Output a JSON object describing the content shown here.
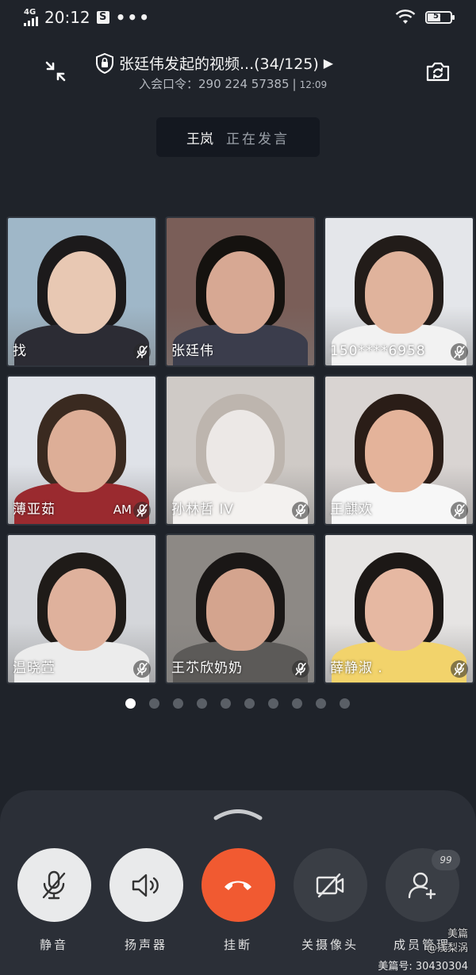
{
  "status_bar": {
    "network": "4G",
    "time": "20:12",
    "extra_icon": "S",
    "dots": "•••",
    "battery": "57",
    "battery_level": 0.57
  },
  "header": {
    "title": "张廷伟发起的视频...(34/125)",
    "code_label": "入会口令：290 224 57385",
    "separator": "|",
    "duration": "12:09"
  },
  "speaker": {
    "name": "王岚",
    "status": "正在发言"
  },
  "participants": [
    {
      "name": "找",
      "muted": true,
      "bg": "#9fb7c8",
      "skin": "#e8c8b3",
      "hair": "#1c1a1b",
      "shirt": "#2c2c34",
      "extra": ""
    },
    {
      "name": "张廷伟",
      "muted": false,
      "bg": "#7a5e58",
      "skin": "#d7a893",
      "hair": "#15120f",
      "shirt": "#3b3d4c",
      "extra": ""
    },
    {
      "name": "150****6958",
      "muted": true,
      "bg": "#e4e6ea",
      "skin": "#e0b39c",
      "hair": "#221c19",
      "shirt": "#f2f2f2",
      "extra": ""
    },
    {
      "name": "薄亚茹",
      "muted": true,
      "bg": "#dfe2e8",
      "skin": "#ddae97",
      "hair": "#3a2a20",
      "shirt": "#9a2a2f",
      "extra": "AM"
    },
    {
      "name": "孙林哲 IV",
      "muted": true,
      "bg": "#cfcac6",
      "skin": "#ece8e6",
      "hair": "#bdb5ae",
      "shirt": "#f3f1ef",
      "extra": ""
    },
    {
      "name": "王麒欢",
      "muted": true,
      "bg": "#d9d4d2",
      "skin": "#e4b39a",
      "hair": "#2a1d17",
      "shirt": "#f7f7f7",
      "extra": ""
    },
    {
      "name": "温晓萱",
      "muted": true,
      "bg": "#d4d6da",
      "skin": "#dfb19c",
      "hair": "#1f1b18",
      "shirt": "#ececec",
      "extra": ""
    },
    {
      "name": "王䒕欣奶奶",
      "muted": true,
      "bg": "#8d8985",
      "skin": "#d4a48e",
      "hair": "#1a1716",
      "shirt": "#5c5a58",
      "extra": ""
    },
    {
      "name": "薛静淑 .",
      "muted": true,
      "bg": "#e6e4e3",
      "skin": "#e6b8a2",
      "hair": "#1c1816",
      "shirt": "#f2d36b",
      "extra": ""
    }
  ],
  "pagination": {
    "count": 10,
    "active": 0
  },
  "controls": {
    "mute_label": "静音",
    "speaker_label": "扬声器",
    "hangup_label": "挂断",
    "camera_label": "关摄像头",
    "members_label": "成员管理",
    "members_badge": "99"
  },
  "watermark": {
    "line1": "美篇",
    "line2": "@浅梨涡",
    "id": "美篇号: 30430304"
  },
  "colors": {
    "background": "#1f232a",
    "hangup": "#f15a31",
    "panel": "#2b2f37"
  }
}
